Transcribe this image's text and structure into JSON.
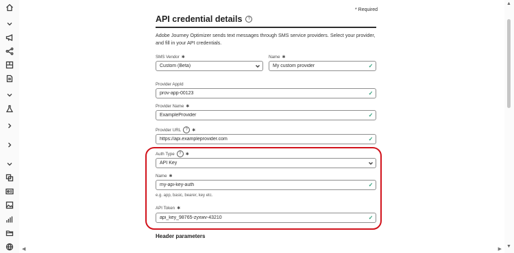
{
  "page": {
    "required_note": "* Required",
    "title": "API credential details",
    "description": "Adobe Journey Optimizer sends text messages through SMS service providers. Select your provider, and fill in your API credentials."
  },
  "sidebar": {
    "icons": [
      "home-icon",
      "chevron-down-icon",
      "megaphone-icon",
      "share-nodes-icon",
      "content-icon",
      "document-icon",
      "chevron-down-icon",
      "flask-icon",
      "chevron-right-icon",
      "chevron-right-icon",
      "chevron-down-icon",
      "copy-icon",
      "id-card-icon",
      "image-icon",
      "bar-chart-icon",
      "folders-icon",
      "globe-icon"
    ]
  },
  "form": {
    "sms_vendor": {
      "label": "SMS Vendor",
      "value": "Custom (Beta)"
    },
    "name": {
      "label": "Name",
      "value": "My custom provider"
    },
    "provider_appid": {
      "label": "Provider AppId",
      "value": "prov-app-00123"
    },
    "provider_name": {
      "label": "Provider Name",
      "value": "ExampleProvider"
    },
    "provider_url": {
      "label": "Provider URL",
      "value": "https://api.exampleprovider.com"
    },
    "auth_type": {
      "label": "Auth Type",
      "value": "API Key"
    },
    "auth_name": {
      "label": "Name",
      "value": "my-api-key-auth",
      "hint": "e.g. app, basic, bearer, key etc."
    },
    "api_token": {
      "label": "API Token",
      "value": "api_key_98765-zyxwv-43210"
    }
  },
  "sections": {
    "header_parameters": "Header parameters"
  },
  "colors": {
    "valid_check": "#2d9d78",
    "highlight": "#d1111a"
  }
}
